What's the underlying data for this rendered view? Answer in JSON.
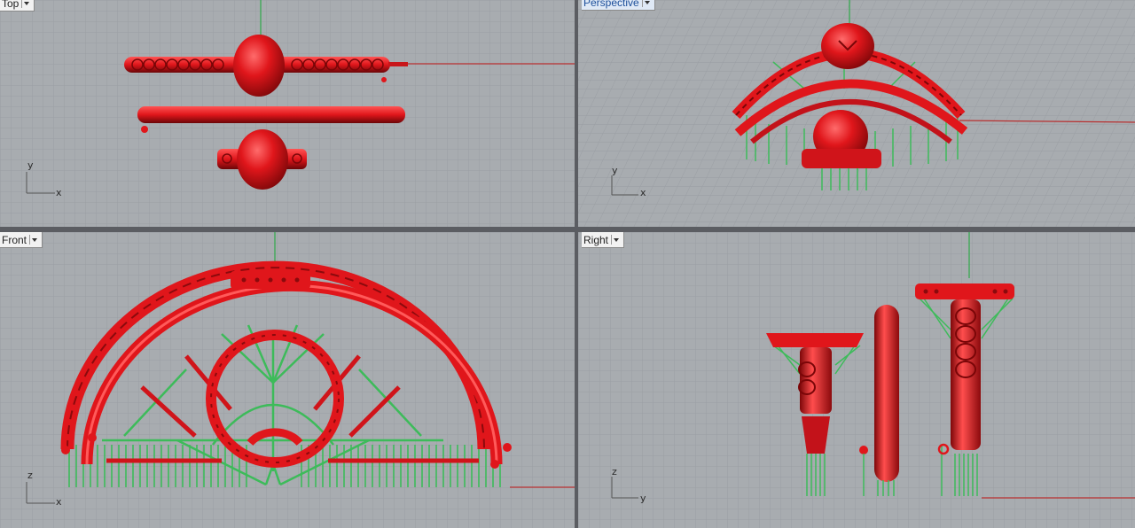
{
  "viewports": {
    "top": {
      "label": "Top",
      "axes": {
        "vertical": "y",
        "horizontal": "x"
      }
    },
    "perspective": {
      "label": "Perspective",
      "axes": {
        "vertical": "y",
        "horizontal": "x"
      }
    },
    "front": {
      "label": "Front",
      "axes": {
        "vertical": "z",
        "horizontal": "x"
      }
    },
    "right": {
      "label": "Right",
      "axes": {
        "vertical": "z",
        "horizontal": "y"
      }
    }
  },
  "colors": {
    "grid_bg": "#a8acb0",
    "grid_line": "#9a9ea3",
    "model_red": "#e0161b",
    "support_green": "#3dbb5a",
    "x_axis": "#b83030",
    "y_axis": "#2fa84a"
  }
}
